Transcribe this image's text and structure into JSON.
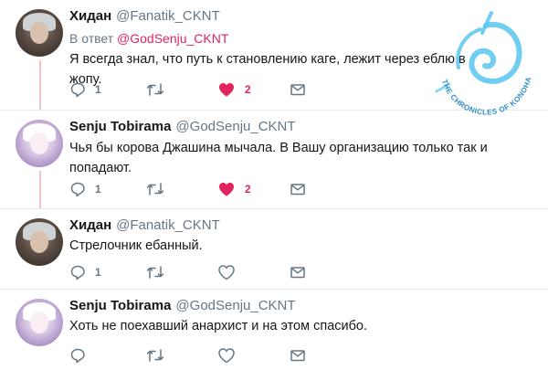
{
  "tweets": [
    {
      "name": "Хидан",
      "handle": "@Fanatik_CKNT",
      "reply_prefix": "В ответ",
      "reply_mention": "@GodSenju_CKNT",
      "text": "Я всегда знал, что путь к становлению каге, лежит через еблю в жопу.",
      "replies": "1",
      "likes": "2",
      "liked": true
    },
    {
      "name": "Senju Tobirama",
      "handle": "@GodSenju_CKNT",
      "text": "Чья бы корова Джашина мычала. В Вашу организацию только так и попадают.",
      "replies": "1",
      "likes": "2",
      "liked": true
    },
    {
      "name": "Хидан",
      "handle": "@Fanatik_CKNT",
      "text": "Стрелочник ебанный.",
      "replies": "1",
      "likes": "",
      "liked": false
    },
    {
      "name": "Senju Tobirama",
      "handle": "@GodSenju_CKNT",
      "text": "Хоть не поехавший анархист и на этом спасибо.",
      "replies": "",
      "likes": "",
      "liked": false
    }
  ],
  "watermark": {
    "caption": "THE CHRONICLES OF KONOHA"
  },
  "colors": {
    "like_active": "#e0245e",
    "mention": "#e0245e",
    "thread_line": "#f7c1c4",
    "icon_grey": "#657786",
    "watermark": "#58c6f0"
  },
  "icons": {
    "reply": "reply-icon",
    "retweet": "retweet-icon",
    "like": "heart-icon",
    "message": "envelope-icon"
  }
}
